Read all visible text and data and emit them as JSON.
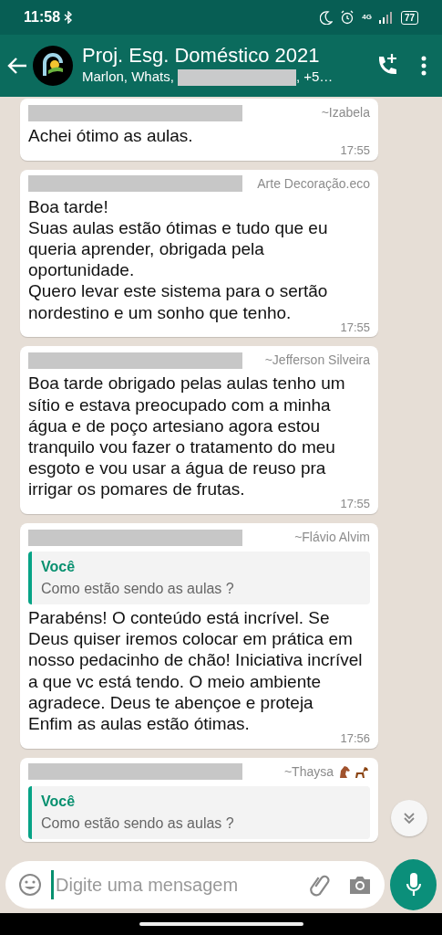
{
  "status_bar": {
    "time": "11:58",
    "battery": "77",
    "network": "4G"
  },
  "header": {
    "title": "Proj. Esg. Doméstico 2021",
    "members_start": "Marlon, Whats,",
    "members_end": ", +5…"
  },
  "messages": [
    {
      "sender": "~Izabela",
      "text": "Achei ótimo as aulas.",
      "time": "17:55"
    },
    {
      "sender": "Arte Decoração.eco",
      "text": "Boa tarde!\nSuas aulas estão ótimas e tudo que eu queria aprender, obrigada pela oportunidade.\nQuero levar este sistema para o sertão nordestino e um sonho que tenho.",
      "time": "17:55"
    },
    {
      "sender": "~Jefferson Silveira",
      "text": "Boa tarde obrigado pelas aulas tenho um sítio e estava preocupado com a minha água e de poço artesiano agora estou tranquilo vou fazer o tratamento do meu esgoto e vou usar a água  de reuso pra irrigar os pomares de frutas.",
      "time": "17:55"
    },
    {
      "sender": "~Flávio Alvim",
      "quote": {
        "author": "Você",
        "text": "Como estão sendo as aulas ?"
      },
      "text": "Parabéns! O conteúdo está incrível. Se Deus quiser iremos colocar em prática em nosso pedacinho de chão! Iniciativa incrível a que vc está tendo. O meio ambiente agradece. Deus te abençoe e proteja\nEnfim as aulas estão ótimas.",
      "time": "17:56"
    },
    {
      "sender": "~Thaysa",
      "horses": true,
      "quote": {
        "author": "Você",
        "text": "Como estão sendo as aulas ?"
      }
    }
  ],
  "composer": {
    "placeholder": "Digite uma mensagem"
  }
}
